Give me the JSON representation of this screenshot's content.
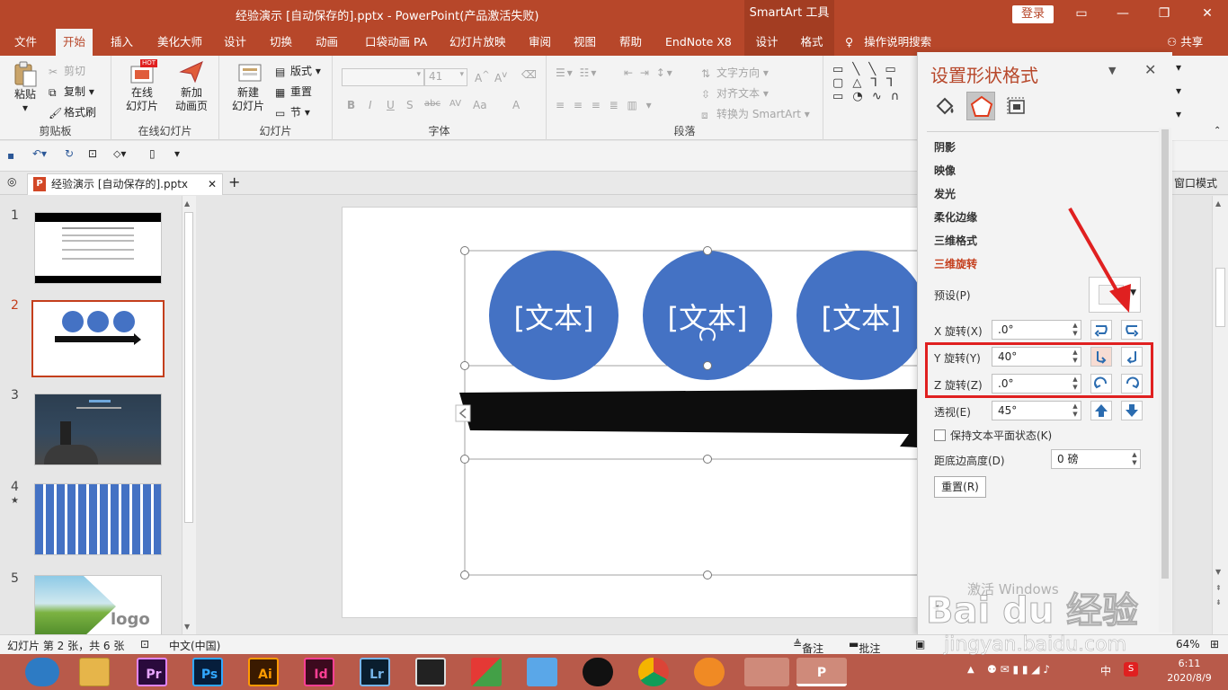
{
  "window": {
    "title": "经验演示 [自动保存的].pptx  -  PowerPoint(产品激活失败)",
    "context_tool": "SmartArt 工具",
    "login": "登录"
  },
  "tabs": {
    "file": "文件",
    "home": "开始",
    "insert": "插入",
    "beautify": "美化大师",
    "design": "设计",
    "transitions": "切换",
    "animations": "动画",
    "pocket": "口袋动画 PA",
    "slideshow": "幻灯片放映",
    "review": "审阅",
    "view": "视图",
    "help": "帮助",
    "endnote": "EndNote X8",
    "sa_design": "设计",
    "sa_format": "格式",
    "tell_me": "操作说明搜索",
    "share": "共享"
  },
  "ribbon": {
    "clipboard": {
      "label": "剪贴板",
      "paste": "粘贴",
      "cut": "剪切",
      "copy": "复制",
      "painter": "格式刷"
    },
    "online": {
      "label": "在线幻灯片",
      "online_slide": "在线\n幻灯片",
      "new_anim": "新加\n动画页",
      "hot": "HOT"
    },
    "slides": {
      "label": "幻灯片",
      "new_slide": "新建\n幻灯片",
      "layout": "版式",
      "reset": "重置",
      "section": "节"
    },
    "font": {
      "label": "字体",
      "size": "41",
      "bold": "B",
      "italic": "I",
      "underline": "U",
      "shadow": "S",
      "strike": "abc",
      "spacing": "AV",
      "case": "Aa",
      "color": "A"
    },
    "paragraph": {
      "label": "段落",
      "text_dir": "文字方向",
      "align_text": "对齐文本",
      "convert": "转换为 SmartArt"
    }
  },
  "doc": {
    "tab_title": "经验演示 [自动保存的].pptx",
    "window_mode": "窗口模式"
  },
  "thumbnails": [
    {
      "num": "1",
      "star": ""
    },
    {
      "num": "2",
      "star": ""
    },
    {
      "num": "3",
      "star": ""
    },
    {
      "num": "4",
      "star": "★"
    },
    {
      "num": "5",
      "star": ""
    }
  ],
  "thumb_logo": "logo",
  "slide": {
    "circles": [
      "[文本]",
      "[文本]",
      "[文本]"
    ],
    "circle_color": "#4472c4"
  },
  "pane": {
    "title": "设置形状格式",
    "sections": [
      "阴影",
      "映像",
      "发光",
      "柔化边缘",
      "三维格式",
      "三维旋转"
    ],
    "preset": "预设(P)",
    "x_label": "X 旋转(X)",
    "x_value": ".0°",
    "y_label": "Y 旋转(Y)",
    "y_value": "40°",
    "z_label": "Z 旋转(Z)",
    "z_value": ".0°",
    "persp_label": "透视(E)",
    "persp_value": "45°",
    "keep_flat": "保持文本平面状态(K)",
    "distance_label": "距底边高度(D)",
    "distance_value": "0 磅",
    "reset": "重置(R)"
  },
  "status": {
    "slide_info": "幻灯片 第 2 张，共 6 张",
    "language": "中文(中国)",
    "notes": "备注",
    "comments": "批注",
    "zoom": "64%"
  },
  "taskbar": {
    "apps": [
      "Pr",
      "Ps",
      "Ai",
      "Id",
      "Lr"
    ],
    "time": "6:11",
    "date": "2020/8/9",
    "ime": "中"
  },
  "watermark": {
    "brand": "Bai du 经验",
    "url": "jingyan.baidu.com",
    "activate": "激活 Windows"
  },
  "colors": {
    "accent": "#b7472a",
    "highlight": "#e02020"
  }
}
